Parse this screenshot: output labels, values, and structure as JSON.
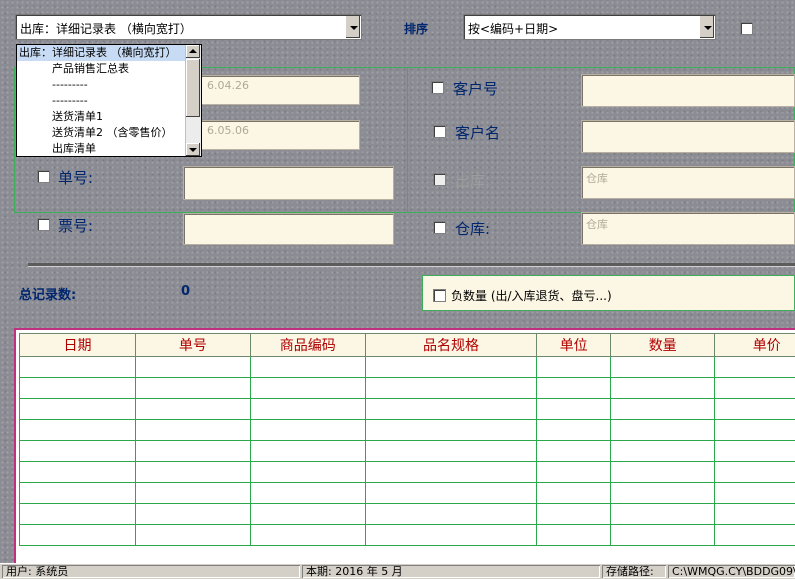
{
  "report_select": {
    "value": "出库：详细记录表 （横向宽打）"
  },
  "sort": {
    "label": "排序",
    "value": "按<编码+日期>"
  },
  "dropdown": {
    "items": [
      "出库：详细记录表 （横向宽打）",
      "产品销售汇总表",
      "---------",
      "---------",
      "送货清单1",
      "送货清单2 （含零售价）",
      "出库清单"
    ],
    "selected_index": 0
  },
  "filters": {
    "date_from": "6.04.26",
    "date_to": "6.05.06",
    "order_no_label": "单号:",
    "ticket_no_label": "票号:",
    "customer_no_label": "客户号",
    "customer_name_label": "客户名",
    "outbound_label": "出库:",
    "outbound_placeholder": "仓库",
    "warehouse_label": "仓库:",
    "warehouse_placeholder": "仓库"
  },
  "summary": {
    "total_label": "总记录数:",
    "total_value": "0",
    "negative_qty_label": "负数量 (出/入库退货、盘亏...)"
  },
  "table": {
    "columns": [
      "日期",
      "单号",
      "商品编码",
      "品名规格",
      "单位",
      "数量",
      "单价"
    ],
    "row_count": 9
  },
  "status_bar": {
    "user": "用户:  系统员",
    "period": "本期:  2016 年 5 月",
    "path_label": "存储路径:",
    "path_value": "C:\\WMQG.CY\\BDDG09\\"
  },
  "colors": {
    "panel": "#fcf6e4",
    "label": "#00266e",
    "header_text": "#b00000",
    "grid_line": "#2aa84a"
  }
}
